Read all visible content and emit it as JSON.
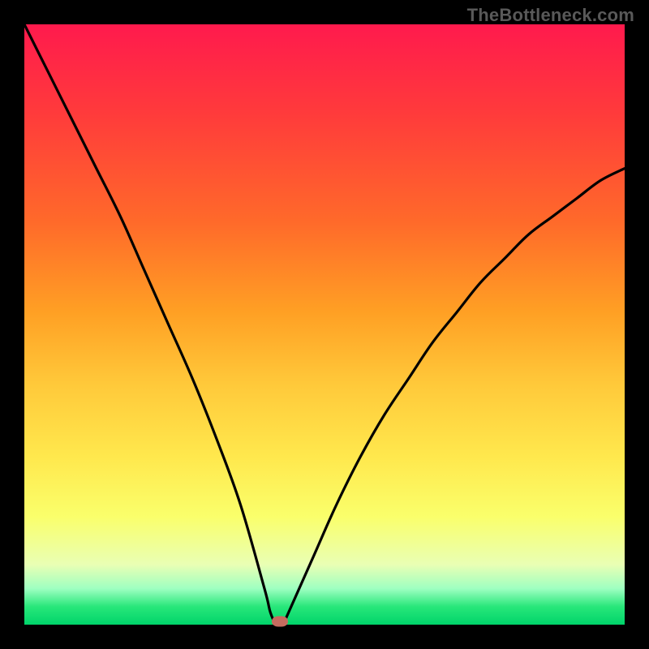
{
  "watermark": "TheBottleneck.com",
  "colors": {
    "frame": "#000000",
    "gradient_top": "#ff1a4d",
    "gradient_bottom": "#00d46a",
    "curve": "#000000",
    "marker": "#c66b5f"
  },
  "chart_data": {
    "type": "line",
    "title": "",
    "xlabel": "",
    "ylabel": "",
    "xlim": [
      0,
      100
    ],
    "ylim": [
      0,
      100
    ],
    "grid": false,
    "series": [
      {
        "name": "bottleneck-curve",
        "x": [
          0,
          4,
          8,
          12,
          16,
          20,
          24,
          28,
          32,
          36,
          40,
          41,
          42,
          43,
          44,
          48,
          52,
          56,
          60,
          64,
          68,
          72,
          76,
          80,
          84,
          88,
          92,
          96,
          100
        ],
        "values": [
          100,
          92,
          84,
          76,
          68,
          59,
          50,
          41,
          31,
          20,
          6,
          2,
          0,
          0,
          2,
          11,
          20,
          28,
          35,
          41,
          47,
          52,
          57,
          61,
          65,
          68,
          71,
          74,
          76
        ]
      }
    ],
    "annotations": [
      {
        "name": "min-marker",
        "x": 42.5,
        "y": 0
      }
    ]
  }
}
